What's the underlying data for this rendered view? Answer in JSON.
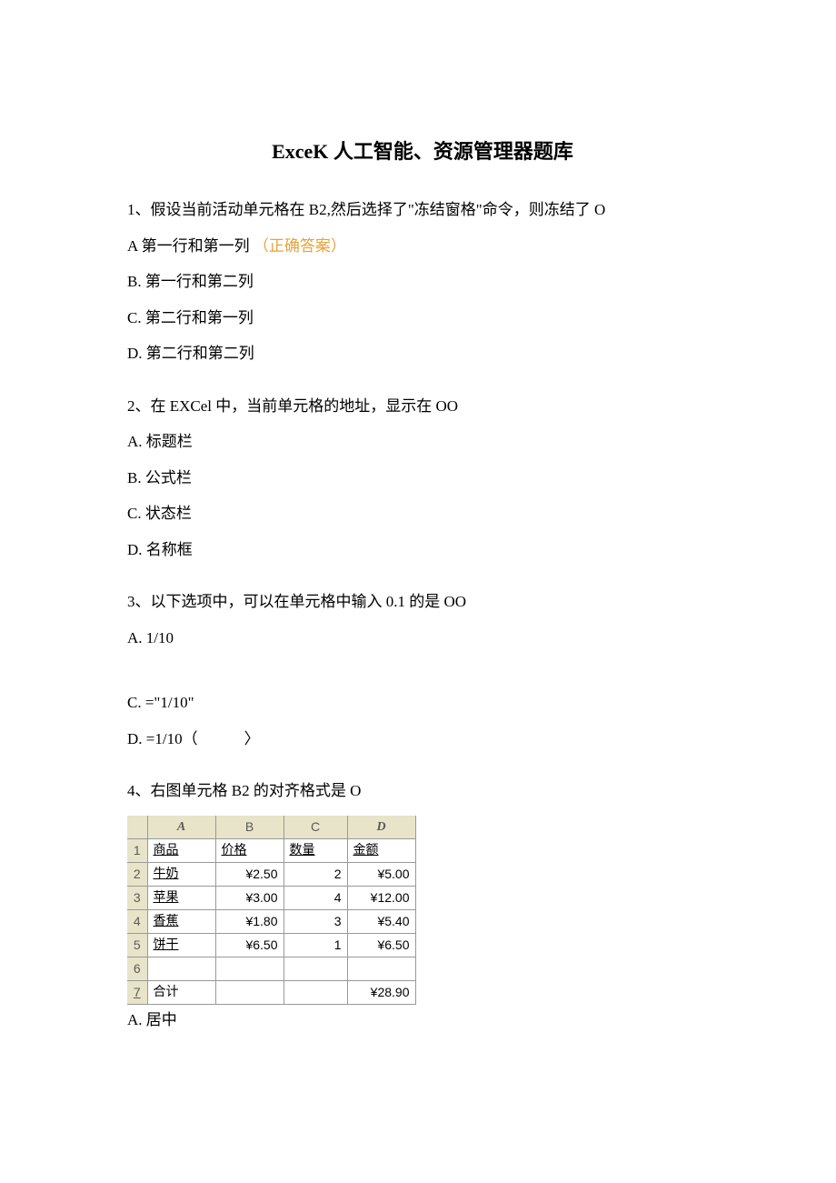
{
  "title": "ExceK 人工智能、资源管理器题库",
  "q1": {
    "stem": "1、假设当前活动单元格在 B2,然后选择了\"冻结窗格\"命令，则冻结了 O",
    "a": "A 第一行和第一列",
    "correct": "（正确答案）",
    "b": "B. 第一行和第二列",
    "c": "C. 第二行和第一列",
    "d": "D. 第二行和第二列"
  },
  "q2": {
    "stem": "2、在 EXCel 中，当前单元格的地址，显示在 OO",
    "a": "A. 标题栏",
    "b": "B. 公式栏",
    "c": "C. 状态栏",
    "d": "D. 名称框"
  },
  "q3": {
    "stem": "3、以下选项中，可以在单元格中输入 0.1 的是 OO",
    "a": "A. 1/10",
    "c": "C. =\"1/10\"",
    "d": "D. =1/10（　　　〉"
  },
  "q4": {
    "stem": "4、右图单元格 B2 的对齐格式是 O",
    "a": "A. 居中"
  },
  "table": {
    "cols": [
      "A",
      "B",
      "C",
      "D"
    ],
    "headers": {
      "A": "商品",
      "B": "价格",
      "C": "数量",
      "D": "金额"
    },
    "rows": [
      {
        "num": "1"
      },
      {
        "num": "2",
        "A": "牛奶",
        "B": "¥2.50",
        "C": "2",
        "D": "¥5.00"
      },
      {
        "num": "3",
        "A": "苹果",
        "B": "¥3.00",
        "C": "4",
        "D": "¥12.00"
      },
      {
        "num": "4",
        "A": "香蕉",
        "B": "¥1.80",
        "C": "3",
        "D": "¥5.40"
      },
      {
        "num": "5",
        "A": "饼干",
        "B": "¥6.50",
        "C": "1",
        "D": "¥6.50"
      },
      {
        "num": "6",
        "A": "",
        "B": "",
        "C": "",
        "D": ""
      },
      {
        "num": "7",
        "A": "合计",
        "B": "",
        "C": "",
        "D": "¥28.90"
      }
    ]
  }
}
